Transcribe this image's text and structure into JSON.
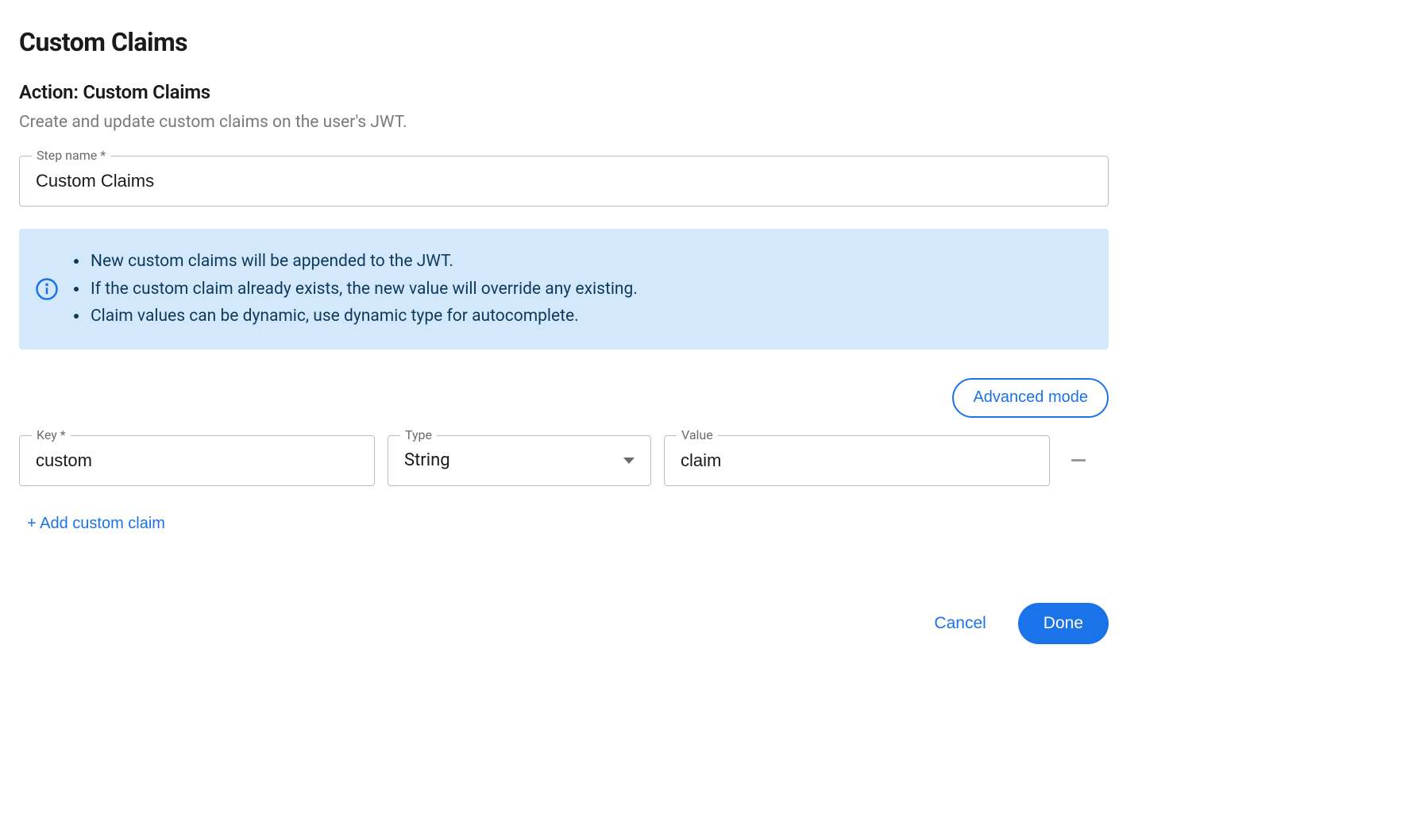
{
  "page": {
    "title": "Custom Claims",
    "action_title": "Action: Custom Claims",
    "description": "Create and update custom claims on the user's JWT."
  },
  "step_name": {
    "label": "Step name *",
    "value": "Custom Claims"
  },
  "info": {
    "items": [
      "New custom claims will be appended to the JWT.",
      "If the custom claim already exists, the new value will override any existing.",
      "Claim values can be dynamic, use dynamic type for autocomplete."
    ]
  },
  "toolbar": {
    "advanced_mode_label": "Advanced mode"
  },
  "claims": {
    "labels": {
      "key": "Key *",
      "type": "Type",
      "value": "Value"
    },
    "rows": [
      {
        "key": "custom",
        "type": "String",
        "value": "claim"
      }
    ]
  },
  "actions": {
    "add_label": "+ Add custom claim",
    "cancel_label": "Cancel",
    "done_label": "Done"
  },
  "colors": {
    "accent": "#1a73e8",
    "info_bg": "#d3e8fb",
    "info_text": "#0d3a5c"
  }
}
